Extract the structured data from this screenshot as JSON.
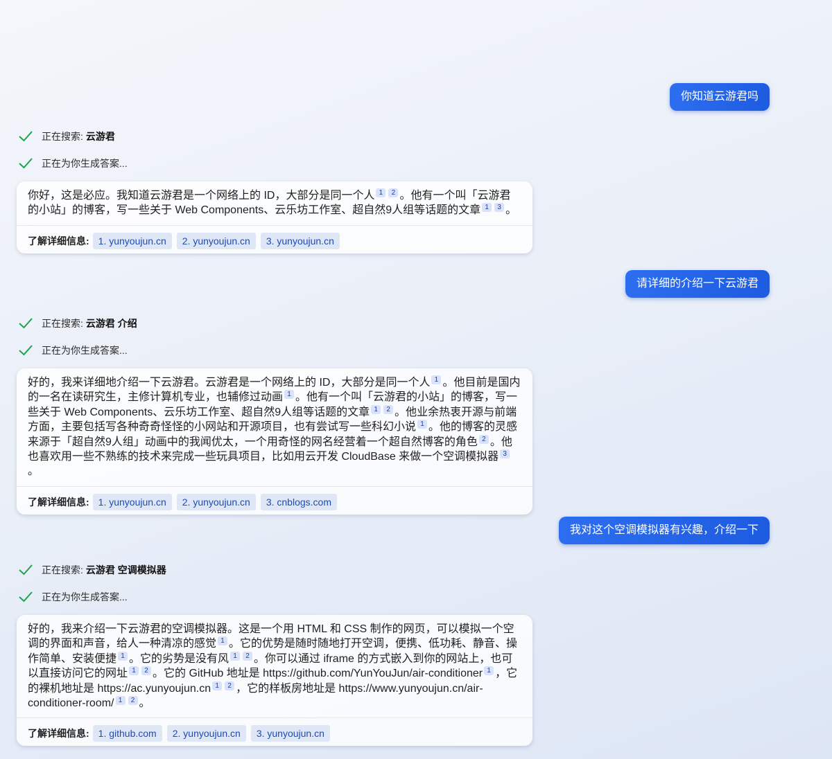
{
  "conversation": [
    {
      "user": "你知道云游君吗",
      "searching_label": "正在搜索:",
      "search_query": "云游君",
      "generating_label": "正在为你生成答案...",
      "answer": [
        {
          "t": "你好，这是必应。我知道云游君是一个网络上的 ID，大部分是同一个人"
        },
        {
          "c": "1"
        },
        {
          "c": "2"
        },
        {
          "t": "。他有一个叫「云游君的小站」的博客，写一些关于 Web Components、云乐坊工作室、超自然9人组等话题的文章"
        },
        {
          "c": "1"
        },
        {
          "c": "3"
        },
        {
          "t": "。"
        }
      ],
      "sources_label": "了解详细信息:",
      "sources": [
        "1. yunyoujun.cn",
        "2. yunyoujun.cn",
        "3. yunyoujun.cn"
      ]
    },
    {
      "user": "请详细的介绍一下云游君",
      "searching_label": "正在搜索:",
      "search_query": "云游君 介绍",
      "generating_label": "正在为你生成答案...",
      "answer": [
        {
          "t": "好的，我来详细地介绍一下云游君。云游君是一个网络上的 ID，大部分是同一个人"
        },
        {
          "c": "1"
        },
        {
          "t": "。他目前是国内的一名在读研究生，主修计算机专业，也辅修过动画"
        },
        {
          "c": "1"
        },
        {
          "t": "。他有一个叫「云游君的小站」的博客，写一些关于 Web Components、云乐坊工作室、超自然9人组等话题的文章"
        },
        {
          "c": "1"
        },
        {
          "c": "2"
        },
        {
          "t": "。他业余热衷开源与前端方面，主要包括写各种奇奇怪怪的小网站和开源项目，也有尝试写一些科幻小说"
        },
        {
          "c": "1"
        },
        {
          "t": "。他的博客的灵感来源于「超自然9人组」动画中的我闻优太，一个用奇怪的网名经营着一个超自然博客的角色"
        },
        {
          "c": "2"
        },
        {
          "t": "。他也喜欢用一些不熟练的技术来完成一些玩具项目，比如用云开发 CloudBase 来做一个空调模拟器"
        },
        {
          "c": "3"
        },
        {
          "t": "。"
        }
      ],
      "sources_label": "了解详细信息:",
      "sources": [
        "1. yunyoujun.cn",
        "2. yunyoujun.cn",
        "3. cnblogs.com"
      ]
    },
    {
      "user": "我对这个空调模拟器有兴趣，介绍一下",
      "searching_label": "正在搜索:",
      "search_query": "云游君 空调模拟器",
      "generating_label": "正在为你生成答案...",
      "answer": [
        {
          "t": "好的，我来介绍一下云游君的空调模拟器。这是一个用 HTML 和 CSS 制作的网页，可以模拟一个空调的界面和声音，给人一种清凉的感觉"
        },
        {
          "c": "1"
        },
        {
          "t": "。它的优势是随时随地打开空调，便携、低功耗、静音、操作简单、安装便捷"
        },
        {
          "c": "1"
        },
        {
          "t": "。它的劣势是没有风"
        },
        {
          "c": "1"
        },
        {
          "c": "2"
        },
        {
          "t": "。你可以通过 iframe 的方式嵌入到你的网站上，也可以直接访问它的网址"
        },
        {
          "c": "1"
        },
        {
          "c": "2"
        },
        {
          "t": "。它的 GitHub 地址是 https://github.com/YunYouJun/air-conditioner"
        },
        {
          "c": "1"
        },
        {
          "t": "，它的裸机地址是 https://ac.yunyoujun.cn"
        },
        {
          "c": "1"
        },
        {
          "c": "2"
        },
        {
          "t": "，它的样板房地址是 https://www.yunyoujun.cn/air-conditioner-room/"
        },
        {
          "c": "1"
        },
        {
          "c": "2"
        },
        {
          "t": "。"
        }
      ],
      "sources_label": "了解详细信息:",
      "sources": [
        "1. github.com",
        "2. yunyoujun.cn",
        "3. yunyoujun.cn"
      ]
    }
  ],
  "colors": {
    "user_bubble": "#1d5be0",
    "check": "#1aa34a",
    "citation_bg": "#d8e2fb",
    "chip_bg": "#dfe7f7",
    "chip_text": "#1d4bb5"
  }
}
